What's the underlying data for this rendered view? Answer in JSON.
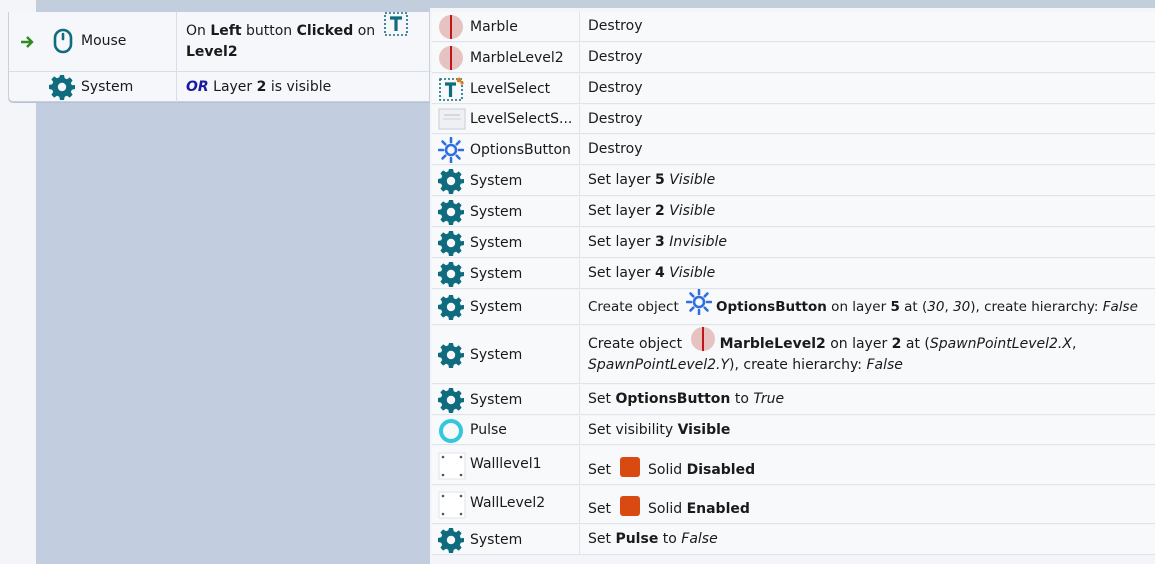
{
  "condition": {
    "row1": {
      "object": "Mouse",
      "parts": [
        "On ",
        "Left",
        " button ",
        "Clicked",
        " on",
        "Level2"
      ]
    },
    "row2": {
      "object": "System",
      "parts": [
        "OR",
        " Layer ",
        "2",
        " is visible"
      ]
    }
  },
  "actions": [
    {
      "object": "Marble",
      "icon": "marble-sprite-icon",
      "text": [
        "Destroy"
      ]
    },
    {
      "object": "MarbleLevel2",
      "icon": "marble-sprite-icon",
      "text": [
        "Destroy"
      ]
    },
    {
      "object": "LevelSelect",
      "icon": "text-object-icon",
      "text": [
        "Destroy"
      ]
    },
    {
      "object": "LevelSelectS...",
      "icon": "level-select-sprite-icon",
      "text": [
        "Destroy"
      ]
    },
    {
      "object": "OptionsButton",
      "icon": "options-button-icon",
      "text": [
        "Destroy"
      ]
    },
    {
      "object": "System",
      "icon": "gear-icon",
      "text": [
        "Set layer ",
        "5",
        " ",
        "Visible"
      ]
    },
    {
      "object": "System",
      "icon": "gear-icon",
      "text": [
        "Set layer ",
        "2",
        " ",
        "Visible"
      ]
    },
    {
      "object": "System",
      "icon": "gear-icon",
      "text": [
        "Set layer ",
        "3",
        " ",
        "Invisible"
      ]
    },
    {
      "object": "System",
      "icon": "gear-icon",
      "text": [
        "Set layer ",
        "4",
        " ",
        "Visible"
      ]
    },
    {
      "object": "System",
      "icon": "gear-icon",
      "text": [
        "Create object ",
        "OptionsButton",
        " on layer ",
        "5",
        " at (",
        "30",
        ", ",
        "30",
        "), create hierarchy: ",
        "False"
      ]
    },
    {
      "object": "System",
      "icon": "gear-icon",
      "text": [
        "Create object ",
        "MarbleLevel2",
        " on layer ",
        "2",
        " at (",
        "SpawnPointLevel2.X",
        ",",
        "SpawnPointLevel2.Y",
        "), create hierarchy: ",
        "False"
      ]
    },
    {
      "object": "System",
      "icon": "gear-icon",
      "text": [
        "Set ",
        "OptionsButton",
        " to ",
        "True"
      ]
    },
    {
      "object": "Pulse",
      "icon": "pulse-ring-icon",
      "text": [
        "Set visibility ",
        "Visible"
      ]
    },
    {
      "object": "Walllevel1",
      "icon": "wall-sprite-icon",
      "text": [
        "Set",
        "Solid ",
        "Disabled"
      ]
    },
    {
      "object": "WallLevel2",
      "icon": "wall-sprite-icon",
      "text": [
        "Set",
        "Solid ",
        "Enabled"
      ]
    },
    {
      "object": "System",
      "icon": "gear-icon",
      "text": [
        "Set ",
        "Pulse",
        " to ",
        "False"
      ]
    }
  ],
  "colors": {
    "gear": "#0f6b7e",
    "solid_swatch": "#d84a12",
    "or_keyword": "#1a1aa0",
    "condition_panel": "#c2cde0"
  }
}
